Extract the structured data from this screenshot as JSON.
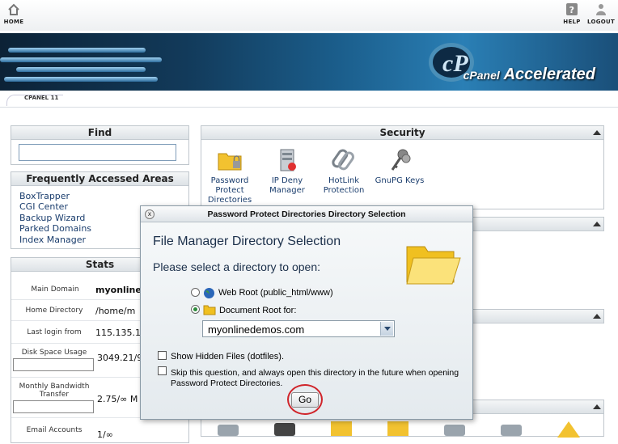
{
  "topbar": {
    "home_label": "HOME",
    "help_label": "HELP",
    "logout_label": "LOGOUT"
  },
  "banner": {
    "logo_letters": "cP",
    "brand": "cPanel",
    "brand_suffix": "Accelerated"
  },
  "ribbon": {
    "label": "CPANEL 11"
  },
  "find": {
    "title": "Find",
    "search_value": ""
  },
  "faa": {
    "title": "Frequently Accessed Areas",
    "links": [
      "BoxTrapper",
      "CGI Center",
      "Backup Wizard",
      "Parked Domains",
      "Index Manager"
    ]
  },
  "stats": {
    "title": "Stats",
    "rows": [
      {
        "label": "Main Domain",
        "value": "myonlined"
      },
      {
        "label": "Home Directory",
        "value": "/home/m"
      },
      {
        "label": "Last login from",
        "value": "115.135.1"
      },
      {
        "label": "Disk Space Usage",
        "value": "3049.21/9"
      },
      {
        "label": "Monthly Bandwidth Transfer",
        "value": "2.75/∞ M"
      },
      {
        "label": "Email Accounts",
        "value": "1/∞"
      }
    ]
  },
  "security": {
    "title": "Security",
    "icons": [
      {
        "label": "Password Protect Directories",
        "icon": "folder-lock-icon"
      },
      {
        "label": "IP Deny Manager",
        "icon": "server-block-icon"
      },
      {
        "label": "HotLink Protection",
        "icon": "chain-icon"
      },
      {
        "label": "GnuPG Keys",
        "icon": "keys-icon"
      }
    ]
  },
  "dialog": {
    "title": "Password Protect Directories Directory Selection",
    "heading": "File Manager Directory Selection",
    "prompt": "Please select a directory to open:",
    "option_webroot": "Web Root (public_html/www)",
    "option_docroot": "Document Root for:",
    "selected_option": "Document Root for:",
    "domain_value": "myonlinedemos.com",
    "show_hidden_label": "Show Hidden Files (dotfiles).",
    "show_hidden_checked": false,
    "skip_label": "Skip this question, and always open this directory in the future when opening Password Protect Directories.",
    "skip_checked": false,
    "go_label": "Go"
  },
  "colors": {
    "accent": "#1a3d6d",
    "highlight_circle": "#d0242a"
  }
}
